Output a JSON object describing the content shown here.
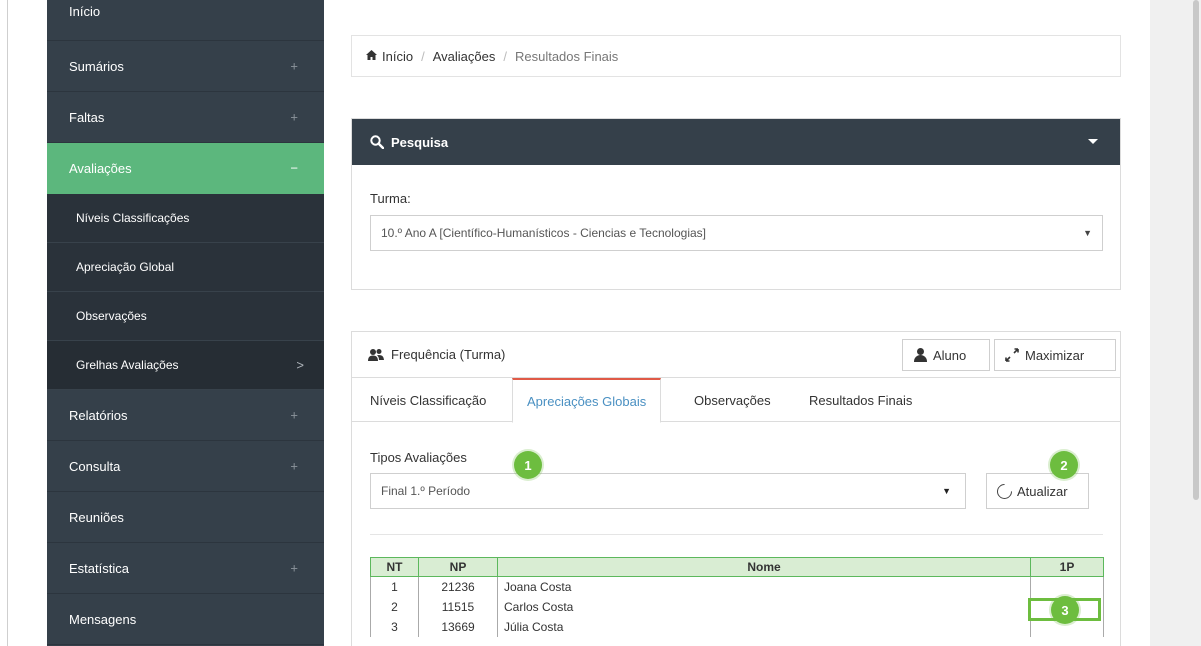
{
  "sidebar": {
    "items": [
      {
        "label": "Início"
      },
      {
        "label": "Sumários",
        "toggle": "+"
      },
      {
        "label": "Faltas",
        "toggle": "+"
      },
      {
        "label": "Avaliações",
        "toggle": "−"
      },
      {
        "label": "Relatórios",
        "toggle": "+"
      },
      {
        "label": "Consulta",
        "toggle": "+"
      },
      {
        "label": "Reuniões"
      },
      {
        "label": "Estatística",
        "toggle": "+"
      },
      {
        "label": "Mensagens"
      }
    ],
    "sub": [
      {
        "label": "Níveis Classificações"
      },
      {
        "label": "Apreciação Global"
      },
      {
        "label": "Observações"
      },
      {
        "label": "Grelhas Avaliações",
        "chevron": ">"
      }
    ]
  },
  "breadcrumb": {
    "home": "Início",
    "sep": "/",
    "level2": "Avaliações",
    "current": "Resultados Finais"
  },
  "search": {
    "title": "Pesquisa",
    "turma_label": "Turma:",
    "turma_value": "10.º Ano A [Científico-Humanísticos - Ciencias e Tecnologias]"
  },
  "freq": {
    "title": "Frequência (Turma)",
    "aluno_label": "Aluno",
    "max_label": "Maximizar",
    "tabs": [
      {
        "label": "Níveis Classificação"
      },
      {
        "label": "Apreciações Globais"
      },
      {
        "label": "Observações"
      },
      {
        "label": "Resultados Finais"
      }
    ],
    "tipos_label": "Tipos Avaliações",
    "tipos_value": "Final 1.º Período",
    "atualizar_label": "Atualizar",
    "table": {
      "headers": [
        "NT",
        "NP",
        "Nome",
        "1P"
      ],
      "rows": [
        {
          "nt": "1",
          "np": "21236",
          "nome": "Joana Costa",
          "p1": ""
        },
        {
          "nt": "2",
          "np": "11515",
          "nome": "Carlos Costa",
          "p1": ""
        },
        {
          "nt": "3",
          "np": "13669",
          "nome": "Júlia Costa",
          "p1": ""
        }
      ]
    }
  },
  "badges": [
    "1",
    "2",
    "3"
  ],
  "colors": {
    "sidebar": "#35404a",
    "active": "#5cb77d",
    "tab_active_text": "#4a90c2",
    "badge": "#6dbd3f"
  }
}
